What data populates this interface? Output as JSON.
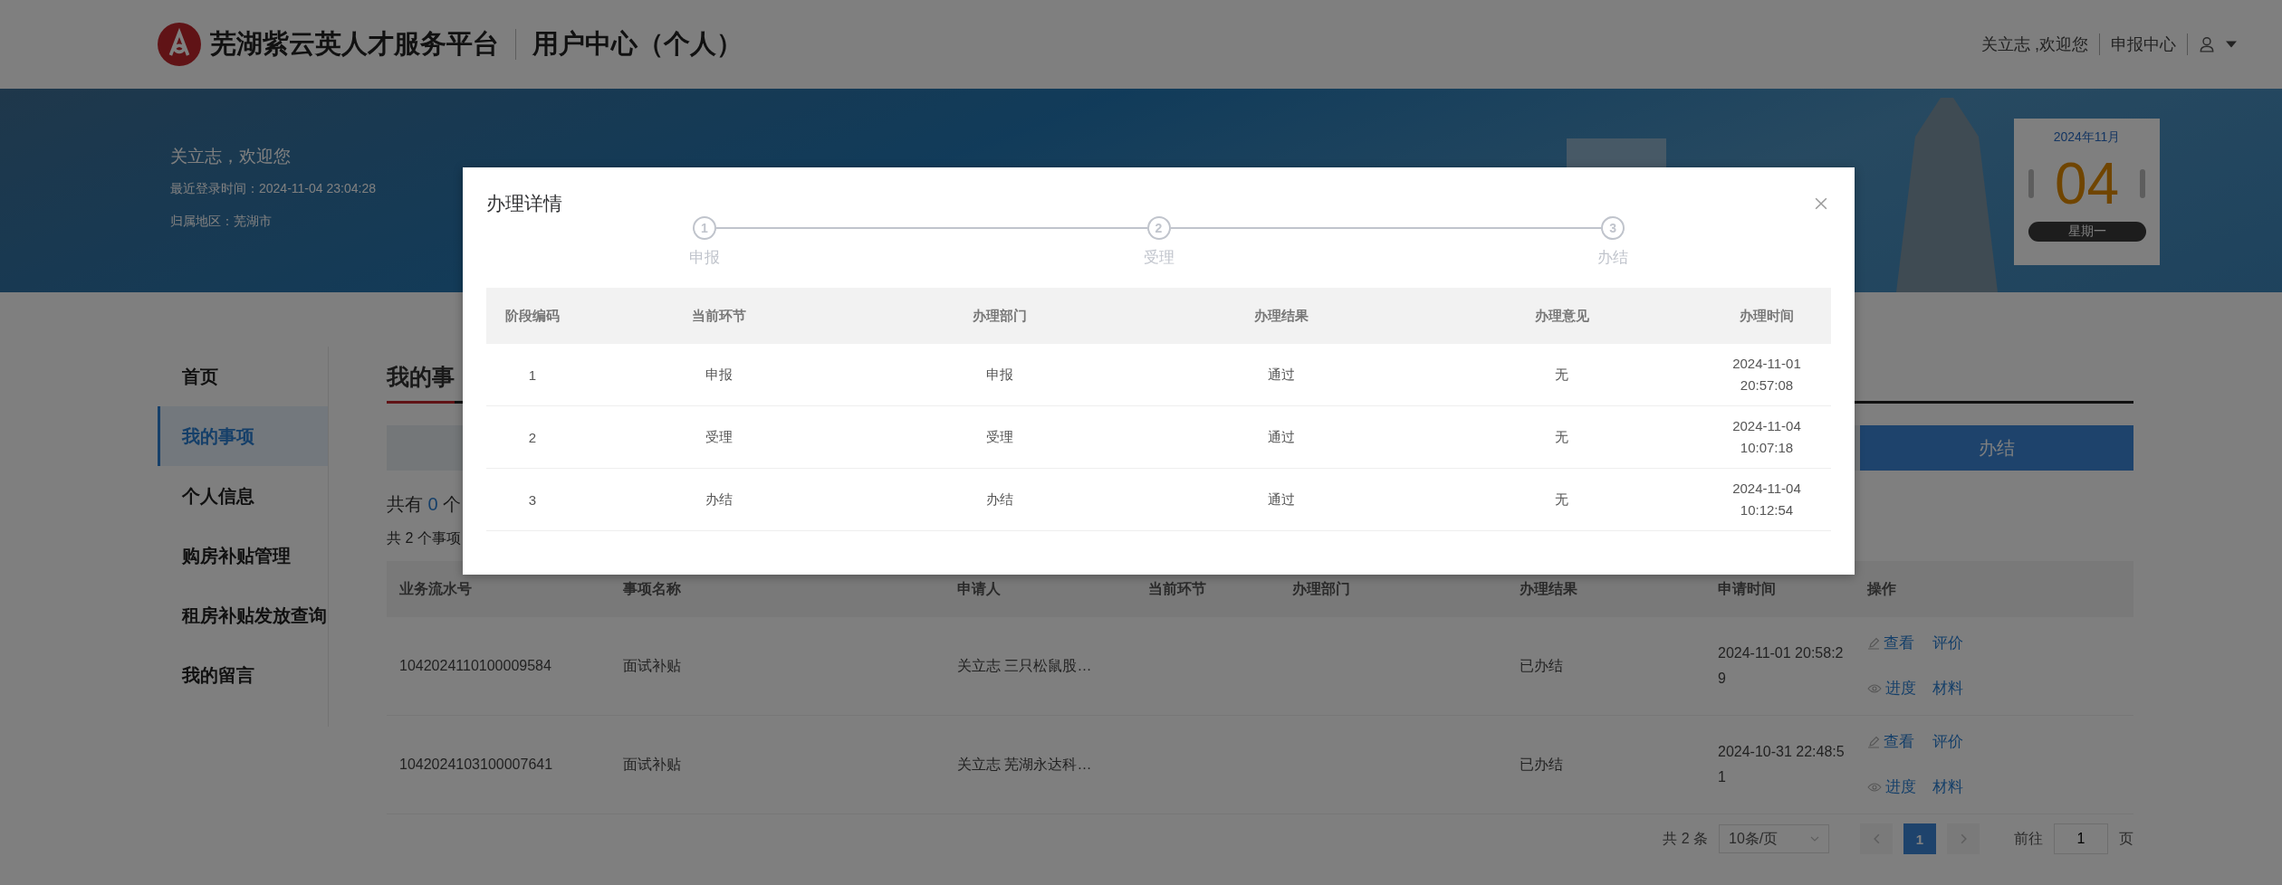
{
  "header": {
    "site_title": "芜湖紫云英人才服务平台",
    "section_title": "用户中心（个人）",
    "greeting": "关立志 ,欢迎您",
    "link": "申报中心"
  },
  "banner": {
    "welcome": "关立志，欢迎您",
    "last_login": "最近登录时间：2024-11-04 23:04:28",
    "region": "归属地区：芜湖市",
    "calendar": {
      "month": "2024年11月",
      "day": "04",
      "weekday": "星期一"
    }
  },
  "sidebar": {
    "items": [
      {
        "label": "首页",
        "selected": false
      },
      {
        "label": "我的事项",
        "selected": true
      },
      {
        "label": "个人信息",
        "selected": false
      },
      {
        "label": "购房补贴管理",
        "selected": false
      },
      {
        "label": "租房补贴发放查询",
        "selected": false
      },
      {
        "label": "我的留言",
        "selected": false
      }
    ]
  },
  "main": {
    "title": "我的事",
    "tabs": [
      {
        "label": "办结",
        "selected": true
      }
    ],
    "count_line": {
      "prefix": "共有",
      "count": "0",
      "suffix": "个"
    },
    "total_line": "共 2 个事项",
    "table": {
      "columns": [
        "业务流水号",
        "事项名称",
        "申请人",
        "当前环节",
        "办理部门",
        "办理结果",
        "申请时间",
        "操作"
      ],
      "rows": [
        {
          "cells": [
            "1042024110100009584",
            "面试补贴",
            "关立志 三只松鼠股…",
            "",
            "",
            "已办结",
            "2024-11-01 20:58:29"
          ],
          "actions": [
            {
              "label": "查看",
              "kind": "edit"
            },
            {
              "label": "评价",
              "kind": "plain"
            },
            {
              "label": "进度",
              "kind": "view"
            },
            {
              "label": "材料",
              "kind": "plain"
            }
          ]
        },
        {
          "cells": [
            "1042024103100007641",
            "面试补贴",
            "关立志 芜湖永达科…",
            "",
            "",
            "已办结",
            "2024-10-31 22:48:51"
          ],
          "actions": [
            {
              "label": "查看",
              "kind": "edit"
            },
            {
              "label": "评价",
              "kind": "plain"
            },
            {
              "label": "进度",
              "kind": "view"
            },
            {
              "label": "材料",
              "kind": "plain"
            }
          ]
        }
      ]
    },
    "pagination": {
      "total": "共 2 条",
      "page_size": "10条/页",
      "pages": [
        {
          "label": "1",
          "selected": true
        }
      ],
      "goto_label": "前往",
      "goto_value": "1",
      "goto_suffix": "页"
    }
  },
  "dialog": {
    "title": "办理详情",
    "steps": [
      {
        "number": "1",
        "label": "申报"
      },
      {
        "number": "2",
        "label": "受理"
      },
      {
        "number": "3",
        "label": "办结"
      }
    ],
    "columns": [
      "阶段编码",
      "当前环节",
      "办理部门",
      "办理结果",
      "办理意见",
      "办理时间"
    ],
    "rows": [
      [
        "1",
        "申报",
        "申报",
        "通过",
        "无",
        "2024-11-01 20:57:08"
      ],
      [
        "2",
        "受理",
        "受理",
        "通过",
        "无",
        "2024-11-04 10:07:18"
      ],
      [
        "3",
        "办结",
        "办结",
        "通过",
        "无",
        "2024-11-04 10:12:54"
      ]
    ]
  }
}
